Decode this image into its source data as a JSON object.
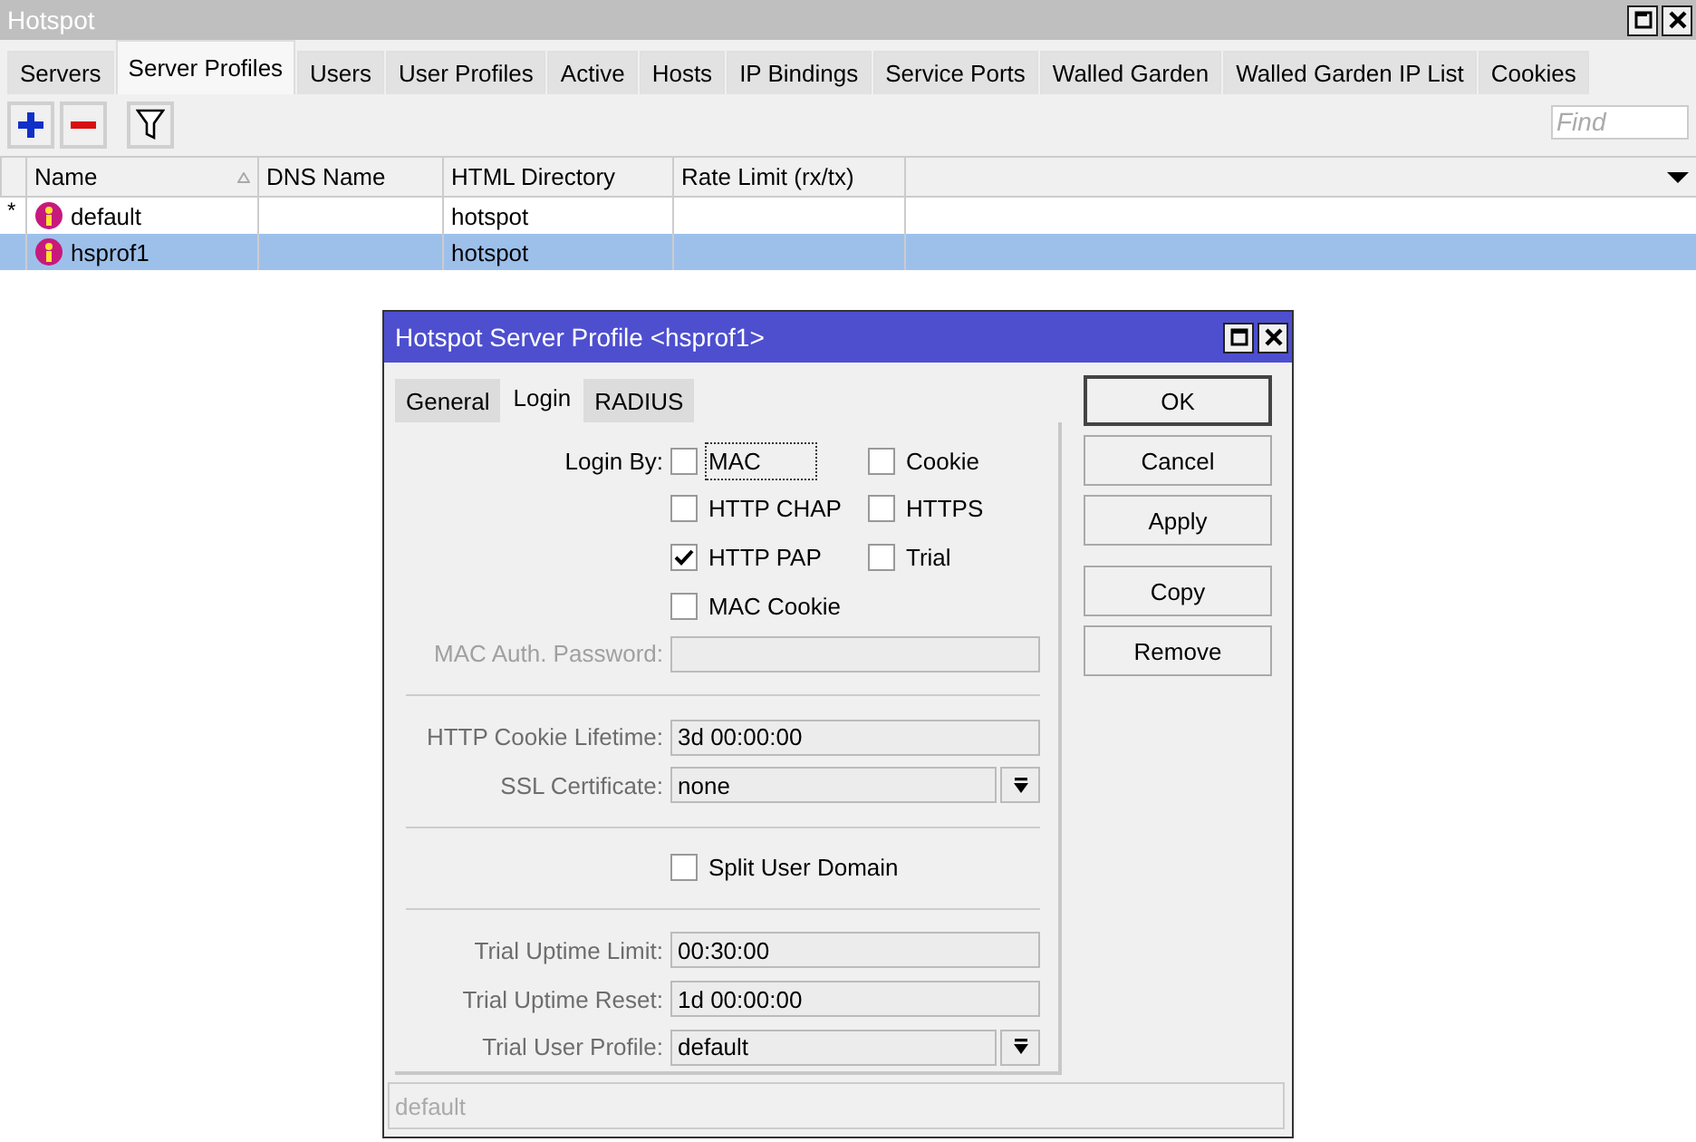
{
  "window": {
    "title": "Hotspot"
  },
  "tabs": [
    {
      "label": "Servers",
      "selected": false
    },
    {
      "label": "Server Profiles",
      "selected": true
    },
    {
      "label": "Users",
      "selected": false
    },
    {
      "label": "User Profiles",
      "selected": false
    },
    {
      "label": "Active",
      "selected": false
    },
    {
      "label": "Hosts",
      "selected": false
    },
    {
      "label": "IP Bindings",
      "selected": false
    },
    {
      "label": "Service Ports",
      "selected": false
    },
    {
      "label": "Walled Garden",
      "selected": false
    },
    {
      "label": "Walled Garden IP List",
      "selected": false
    },
    {
      "label": "Cookies",
      "selected": false
    }
  ],
  "search": {
    "placeholder": "Find"
  },
  "table": {
    "columns": [
      "Name",
      "DNS Name",
      "HTML Directory",
      "Rate Limit (rx/tx)"
    ],
    "rows": [
      {
        "marker": "*",
        "cells": [
          "default",
          "",
          "hotspot",
          ""
        ],
        "selected": false
      },
      {
        "marker": "",
        "cells": [
          "hsprof1",
          "",
          "hotspot",
          ""
        ],
        "selected": true
      }
    ]
  },
  "dialog": {
    "title": "Hotspot Server Profile <hsprof1>",
    "tabs": [
      {
        "label": "General",
        "selected": false
      },
      {
        "label": "Login",
        "selected": true
      },
      {
        "label": "RADIUS",
        "selected": false
      }
    ],
    "rows": [
      {
        "kind": "checks",
        "label": "Login By:",
        "items": [
          {
            "label": "MAC",
            "checked": false,
            "focused": true
          },
          {
            "label": "Cookie",
            "checked": false,
            "focused": false
          }
        ]
      },
      {
        "kind": "checks",
        "items": [
          {
            "label": "HTTP CHAP",
            "checked": false,
            "focused": false
          },
          {
            "label": "HTTPS",
            "checked": false,
            "focused": false
          }
        ]
      },
      {
        "kind": "checks",
        "items": [
          {
            "label": "HTTP PAP",
            "checked": true,
            "focused": false
          },
          {
            "label": "Trial",
            "checked": false,
            "focused": false
          }
        ]
      },
      {
        "kind": "checks",
        "items": [
          {
            "label": "MAC Cookie",
            "checked": false,
            "focused": false
          }
        ]
      },
      {
        "kind": "text",
        "label": "MAC Auth. Password:",
        "disabled": true
      },
      {
        "kind": "divider"
      },
      {
        "kind": "text",
        "label": "HTTP Cookie Lifetime:",
        "value": "3d 00:00:00",
        "disabled": false
      },
      {
        "kind": "select",
        "label": "SSL Certificate:",
        "value": "none"
      },
      {
        "kind": "divider"
      },
      {
        "kind": "checks",
        "items": [
          {
            "label": "Split User Domain",
            "checked": false,
            "focused": false
          }
        ]
      },
      {
        "kind": "divider"
      },
      {
        "kind": "text",
        "label": "Trial Uptime Limit:",
        "value": "00:30:00",
        "disabled": false
      },
      {
        "kind": "text",
        "label": "Trial Uptime Reset:",
        "value": "1d 00:00:00",
        "disabled": false
      },
      {
        "kind": "select",
        "label": "Trial User Profile:",
        "value": "default"
      }
    ],
    "buttons": [
      "OK",
      "Cancel",
      "Apply",
      "Copy",
      "Remove"
    ],
    "status_bar": "default"
  }
}
